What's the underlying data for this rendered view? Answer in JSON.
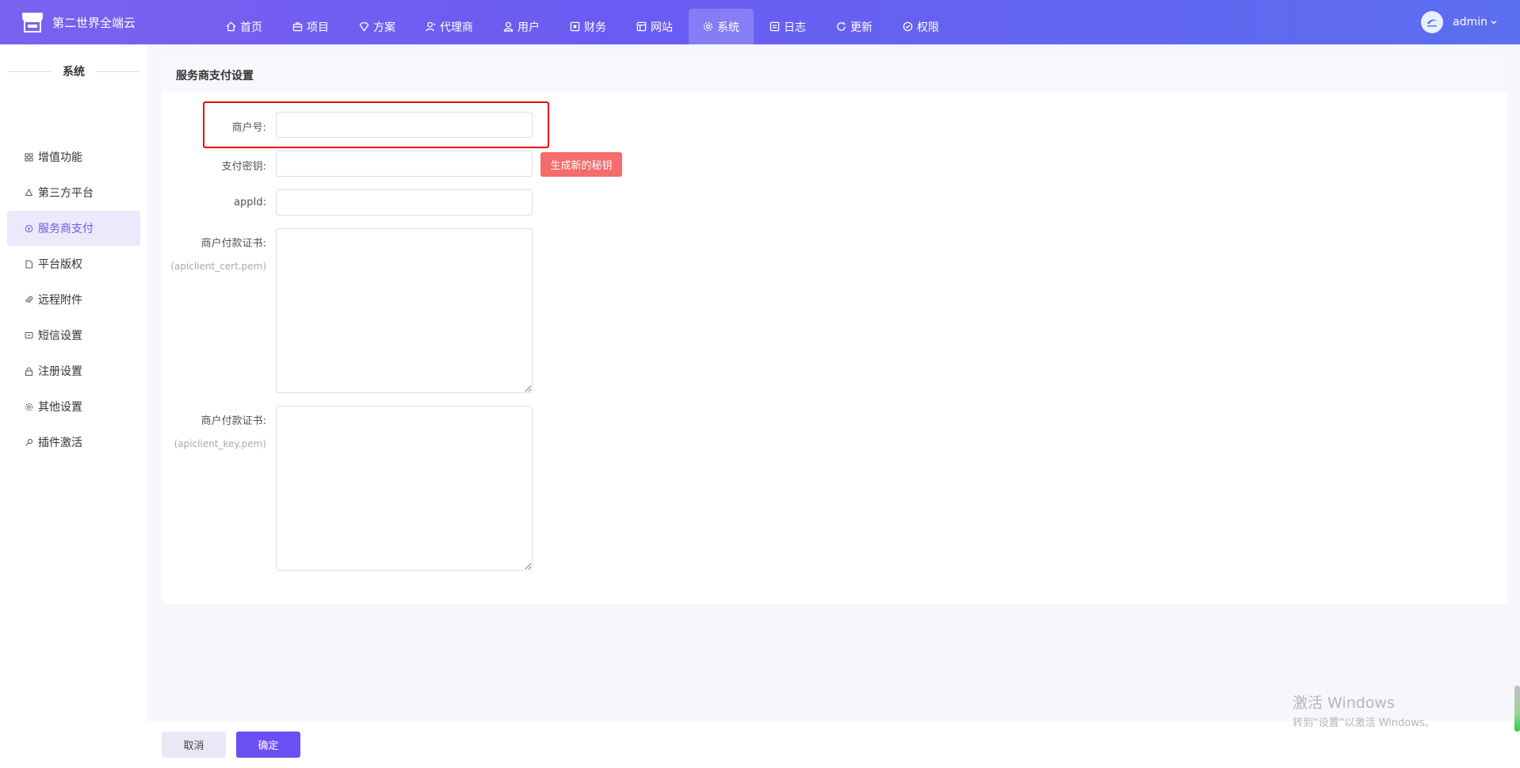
{
  "app": {
    "name": "第二世界全端云",
    "user": "admin"
  },
  "nav": [
    {
      "label": "首页",
      "icon": "home-icon"
    },
    {
      "label": "项目",
      "icon": "briefcase-icon"
    },
    {
      "label": "方案",
      "icon": "diamond-icon"
    },
    {
      "label": "代理商",
      "icon": "agent-icon"
    },
    {
      "label": "用户",
      "icon": "users-icon"
    },
    {
      "label": "财务",
      "icon": "finance-icon"
    },
    {
      "label": "网站",
      "icon": "layout-icon"
    },
    {
      "label": "系统",
      "icon": "gear-icon",
      "active": true
    },
    {
      "label": "日志",
      "icon": "log-icon"
    },
    {
      "label": "更新",
      "icon": "refresh-icon"
    },
    {
      "label": "权限",
      "icon": "shield-check-icon"
    }
  ],
  "sidebar": {
    "title": "系统",
    "items": [
      {
        "label": "增值功能",
        "icon": "grid-icon"
      },
      {
        "label": "第三方平台",
        "icon": "recycle-icon"
      },
      {
        "label": "服务商支付",
        "icon": "pay-icon",
        "active": true
      },
      {
        "label": "平台版权",
        "icon": "document-icon"
      },
      {
        "label": "远程附件",
        "icon": "paperclip-icon"
      },
      {
        "label": "短信设置",
        "icon": "message-icon"
      },
      {
        "label": "注册设置",
        "icon": "lock-icon"
      },
      {
        "label": "其他设置",
        "icon": "gear-icon"
      },
      {
        "label": "插件激活",
        "icon": "key-icon"
      }
    ]
  },
  "form": {
    "title": "服务商支付设置",
    "merchant_label": "商户号:",
    "merchant_value": "",
    "secret_label": "支付密钥:",
    "secret_value": "",
    "generate_label": "生成新的秘钥",
    "appid_label": "appId:",
    "appid_value": "",
    "cert_label": "商户付款证书:",
    "cert_hint": "(apiclient_cert.pem)",
    "key_label": "商户付款证书:",
    "key_hint": "(apiclient_key.pem)"
  },
  "footer": {
    "cancel": "取消",
    "confirm": "确定"
  },
  "watermark": {
    "title": "激活 Windows",
    "subtitle": "转到“设置”以激活 Windows。"
  },
  "colors": {
    "header_start": "#7b61f0",
    "header_end": "#5b6ef0",
    "accent": "#6b4ff2",
    "danger": "#f56c6c",
    "highlight": "#e00000"
  }
}
